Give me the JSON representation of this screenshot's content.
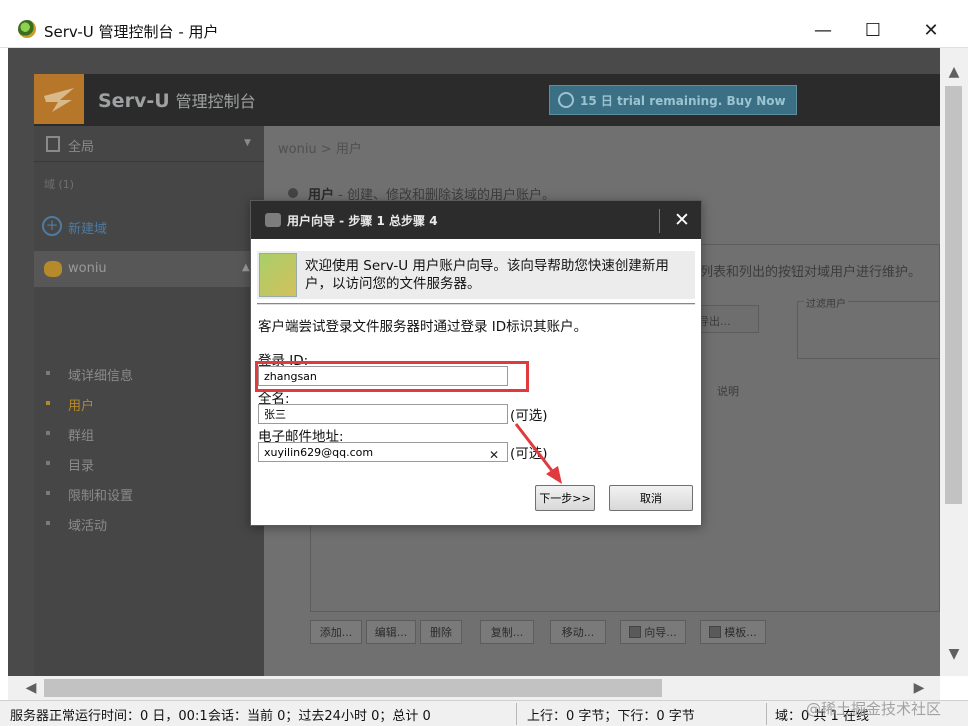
{
  "window": {
    "title": "Serv-U 管理控制台 - 用户",
    "minimize_glyph": "—",
    "maximize_glyph": "☐",
    "close_glyph": "✕"
  },
  "header": {
    "brand": "Serv-U",
    "brand_sub": "管理控制台",
    "trial": "15 日 trial remaining. Buy Now"
  },
  "sidebar": {
    "global": "全局",
    "domain_hint": "域 (1)",
    "new_domain": "新建域",
    "domain_name": "woniu",
    "items": [
      {
        "label": "域详细信息",
        "active": false
      },
      {
        "label": "用户",
        "active": true
      },
      {
        "label": "群组",
        "active": false
      },
      {
        "label": "目录",
        "active": false
      },
      {
        "label": "限制和设置",
        "active": false
      },
      {
        "label": "域活动",
        "active": false
      }
    ]
  },
  "content": {
    "breadcrumb": "woniu  > 用户",
    "intro_bold": "用户",
    "intro_rest": " - 创建、修改和删除该域的用户账户。",
    "desc": "列表和列出的按钮对域用户进行维护。",
    "export_label": "导出...",
    "filter_label": "过滤用户",
    "col_desc": "说明",
    "buttons": [
      "添加...",
      "编辑...",
      "删除",
      "复制...",
      "移动...",
      "向导...",
      "模板..."
    ]
  },
  "dialog": {
    "title": "用户向导 - 步骤 1 总步骤 4",
    "close_glyph": "✕",
    "welcome": "欢迎使用 Serv-U 用户账户向导。该向导帮助您快速创建新用户，以访问您的文件服务器。",
    "lead": "客户端尝试登录文件服务器时通过登录 ID标识其账户。",
    "login_label": "登录 ID:",
    "login_value": "zhangsan",
    "fullname_label": "全名:",
    "fullname_value": "张三",
    "fullname_optional": "(可选)",
    "email_label": "电子邮件地址:",
    "email_value": "xuyilin629@qq.com",
    "email_optional": "(可选)",
    "clear_glyph": "✕",
    "next_label": "下一步>>",
    "cancel_label": "取消"
  },
  "status": {
    "uptime": "服务器正常运行时间：0 日，00:1",
    "sessions": "会话：当前 0；过去24小时 0；总计 0",
    "traffic": "上行：0 字节；下行：0 字节",
    "domains": "域：0 共 1 在线",
    "watermark": "@稀土掘金技术社区"
  },
  "colors": {
    "highlight": "#e0393e",
    "accent_gold": "#b58a2a",
    "trial_bg": "#3b6f84"
  }
}
